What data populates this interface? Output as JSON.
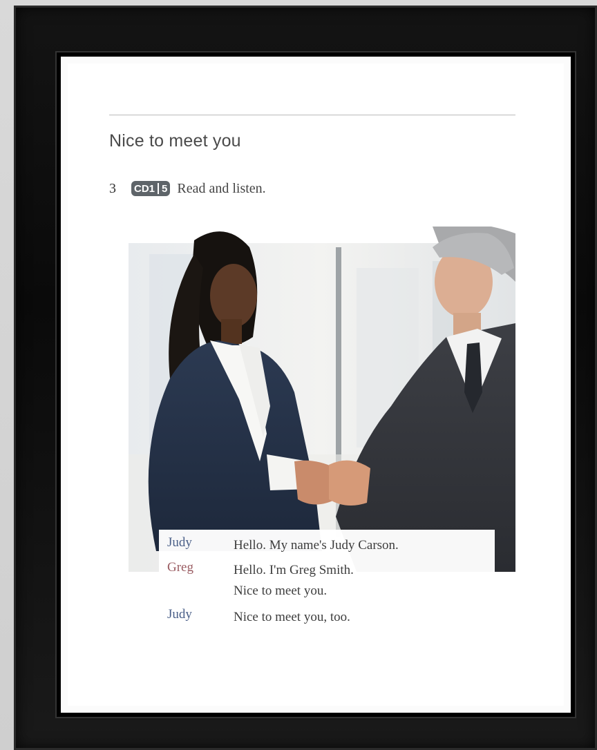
{
  "lesson": {
    "title": "Nice to meet you",
    "exercise_number": "3",
    "cd_label": "CD1",
    "track": "5",
    "instruction": "Read and listen."
  },
  "dialogue": [
    {
      "speaker": "Judy",
      "text": "Hello. My name's Judy Carson."
    },
    {
      "speaker": "Greg",
      "text": "Hello. I'm Greg Smith."
    },
    {
      "speaker": "",
      "text": "Nice to meet you."
    },
    {
      "speaker": "Judy",
      "text": "Nice to meet you, too."
    }
  ],
  "colors": {
    "frame": "#0b0b0b",
    "judy": "#4a5f88",
    "greg": "#9a5c62",
    "badge": "#5e6469"
  }
}
